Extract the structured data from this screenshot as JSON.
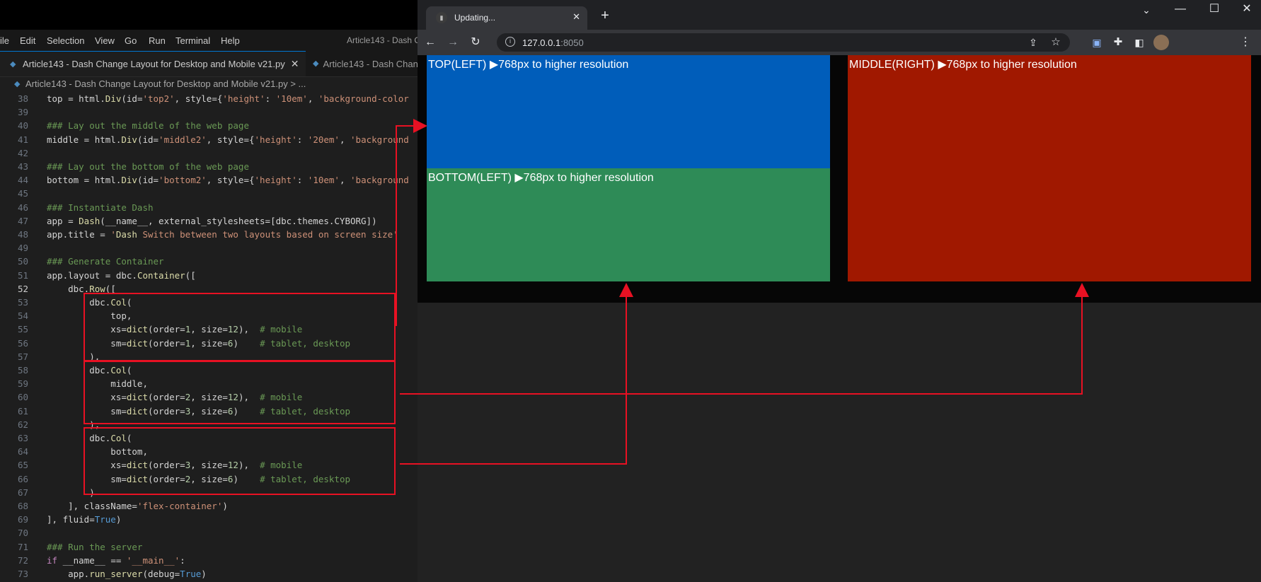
{
  "vscode": {
    "menu": [
      "ile",
      "Edit",
      "Selection",
      "View",
      "Go",
      "Run",
      "Terminal",
      "Help"
    ],
    "window_title": "Article143 - Dash C",
    "tabs": [
      {
        "label": "Article143 - Dash Change Layout for Desktop and Mobile v21.py",
        "active": true
      },
      {
        "label": "Article143 - Dash Chang",
        "active": false
      }
    ],
    "breadcrumb": "Article143 - Dash Change Layout for Desktop and Mobile v21.py > ...",
    "current_line": "52"
  },
  "code_lines": [
    {
      "n": "38",
      "text": "top = html.Div(id='top2', style={'height': '10em', 'background-color"
    },
    {
      "n": "39",
      "text": ""
    },
    {
      "n": "40",
      "text": "### Lay out the middle of the web page"
    },
    {
      "n": "41",
      "text": "middle = html.Div(id='middle2', style={'height': '20em', 'background"
    },
    {
      "n": "42",
      "text": ""
    },
    {
      "n": "43",
      "text": "### Lay out the bottom of the web page"
    },
    {
      "n": "44",
      "text": "bottom = html.Div(id='bottom2', style={'height': '10em', 'background"
    },
    {
      "n": "45",
      "text": ""
    },
    {
      "n": "46",
      "text": "### Instantiate Dash"
    },
    {
      "n": "47",
      "text": "app = Dash(__name__, external_stylesheets=[dbc.themes.CYBORG])"
    },
    {
      "n": "48",
      "text": "app.title = 'Dash Switch between two layouts based on screen size'"
    },
    {
      "n": "49",
      "text": ""
    },
    {
      "n": "50",
      "text": "### Generate Container"
    },
    {
      "n": "51",
      "text": "app.layout = dbc.Container(["
    },
    {
      "n": "52",
      "text": "    dbc.Row(["
    },
    {
      "n": "53",
      "text": "        dbc.Col("
    },
    {
      "n": "54",
      "text": "            top,"
    },
    {
      "n": "55",
      "text": "            xs=dict(order=1, size=12),  # mobile"
    },
    {
      "n": "56",
      "text": "            sm=dict(order=1, size=6)    # tablet, desktop"
    },
    {
      "n": "57",
      "text": "        ),"
    },
    {
      "n": "58",
      "text": "        dbc.Col("
    },
    {
      "n": "59",
      "text": "            middle,"
    },
    {
      "n": "60",
      "text": "            xs=dict(order=2, size=12),  # mobile"
    },
    {
      "n": "61",
      "text": "            sm=dict(order=3, size=6)    # tablet, desktop"
    },
    {
      "n": "62",
      "text": "        ),"
    },
    {
      "n": "63",
      "text": "        dbc.Col("
    },
    {
      "n": "64",
      "text": "            bottom,"
    },
    {
      "n": "65",
      "text": "            xs=dict(order=3, size=12),  # mobile"
    },
    {
      "n": "66",
      "text": "            sm=dict(order=2, size=6)    # tablet, desktop"
    },
    {
      "n": "67",
      "text": "        )"
    },
    {
      "n": "68",
      "text": "    ], className='flex-container')"
    },
    {
      "n": "69",
      "text": "], fluid=True)"
    },
    {
      "n": "70",
      "text": ""
    },
    {
      "n": "71",
      "text": "### Run the server"
    },
    {
      "n": "72",
      "text": "if __name__ == '__main__':"
    },
    {
      "n": "73",
      "text": "    app.run_server(debug=True)"
    }
  ],
  "chrome": {
    "tab_title": "Updating...",
    "new_tab": "+",
    "url_host": "127.0.0.1",
    "url_port": ":8050",
    "window_controls": [
      "minimize",
      "maximize",
      "close"
    ]
  },
  "page": {
    "top_label": "TOP(LEFT) ▶768px to higher resolution",
    "bottom_label": "BOTTOM(LEFT) ▶768px to higher resolution",
    "middle_label": "MIDDLE(RIGHT) ▶768px to higher resolution",
    "colors": {
      "top": "#005dba",
      "bottom": "#2e8b57",
      "middle": "#a01800",
      "annotation": "#e81123"
    }
  }
}
